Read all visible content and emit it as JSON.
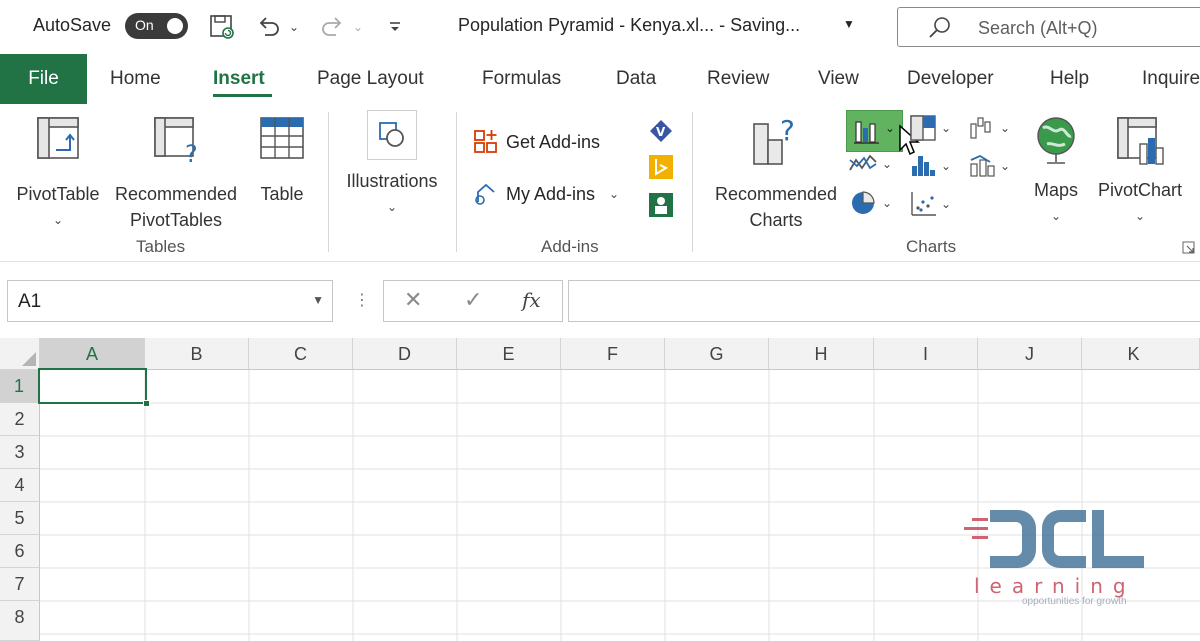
{
  "titlebar": {
    "autosave_label": "AutoSave",
    "autosave_toggle": "On",
    "document_title": "Population Pyramid - Kenya.xl...  -  Saving...",
    "search_placeholder": "Search (Alt+Q)"
  },
  "tabs": {
    "file": "File",
    "items": [
      "Home",
      "Insert",
      "Page Layout",
      "Formulas",
      "Data",
      "Review",
      "View",
      "Developer",
      "Help",
      "Inquire"
    ],
    "active": "Insert"
  },
  "ribbon": {
    "tables": {
      "label": "Tables",
      "pivottable": "PivotTable",
      "recommended_pivot_l1": "Recommended",
      "recommended_pivot_l2": "PivotTables",
      "table": "Table"
    },
    "illustrations": {
      "label": "Illustrations"
    },
    "addins": {
      "label": "Add-ins",
      "get_addins": "Get Add-ins",
      "my_addins": "My Add-ins"
    },
    "charts": {
      "label": "Charts",
      "recommended_l1": "Recommended",
      "recommended_l2": "Charts",
      "maps": "Maps",
      "pivotchart": "PivotChart"
    }
  },
  "formula_bar": {
    "name_box": "A1",
    "fx": "fx",
    "formula": ""
  },
  "sheet": {
    "columns": [
      "A",
      "B",
      "C",
      "D",
      "E",
      "F",
      "G",
      "H",
      "I",
      "J",
      "K"
    ],
    "rows": [
      "1",
      "2",
      "3",
      "4",
      "5",
      "6",
      "7",
      "8"
    ],
    "selected_cell": "A1"
  },
  "watermark": {
    "brand": "OCL",
    "word": "learning",
    "tagline": "opportunities for growth"
  },
  "colors": {
    "excel_green": "#217346",
    "brand_blue": "#3d6e95",
    "brand_red": "#c64a5a"
  }
}
